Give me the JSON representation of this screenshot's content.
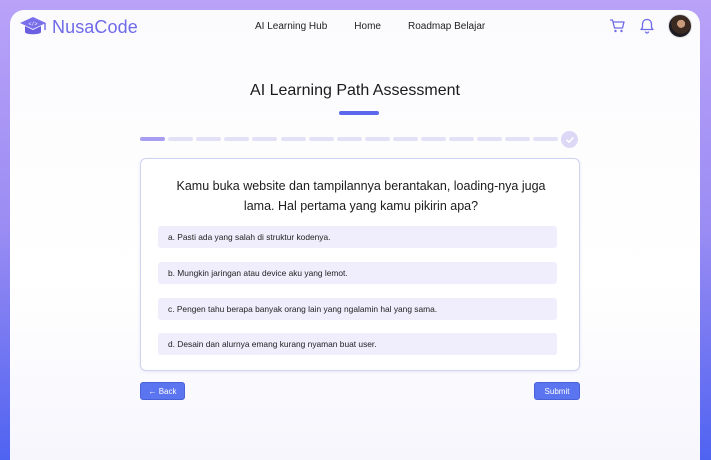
{
  "header": {
    "logo_text": "NusaCode",
    "nav": [
      "AI Learning Hub",
      "Home",
      "Roadmap Belajar"
    ],
    "icons": [
      "cart-icon",
      "bell-icon",
      "avatar"
    ]
  },
  "assessment": {
    "title": "AI Learning Path Assessment",
    "progress": {
      "current": 1,
      "total": 15
    },
    "question": "Kamu buka website dan tampilannya berantakan, loading-nya juga lama. Hal pertama yang kamu pikirin apa?",
    "options": [
      "a. Pasti ada yang salah di struktur kodenya.",
      "b. Mungkin jaringan atau device aku yang lemot.",
      "c. Pengen tahu berapa banyak orang lain yang ngalamin hal yang sama.",
      "d. Desain dan alurnya emang kurang nyaman buat user."
    ],
    "back_label": "← Back",
    "submit_label": "Submit"
  },
  "colors": {
    "brand": "#6f6ae8",
    "accent": "#5b74ef",
    "progress_active": "#a79ef2",
    "progress_inactive": "#e3e1f6",
    "option_bg": "#f0eefc"
  }
}
